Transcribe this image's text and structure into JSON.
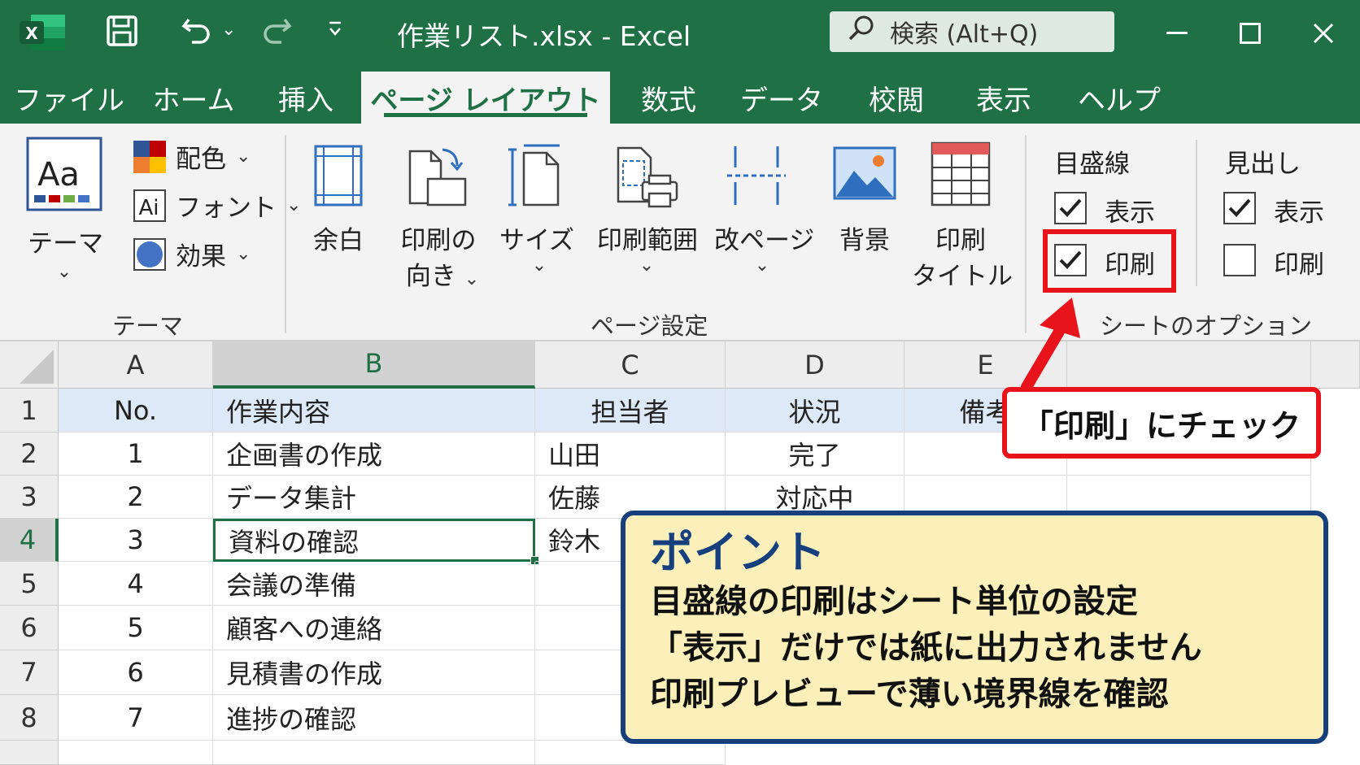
{
  "titlebar": {
    "file_title": "作業リスト.xlsx  -  Excel",
    "search_placeholder": "検索 (Alt+Q)"
  },
  "tabs": [
    "ファイル",
    "ホーム",
    "挿入",
    "ページ レイアウト",
    "数式",
    "データ",
    "校閲",
    "表示",
    "ヘルプ"
  ],
  "active_tab": "ページ レイアウト",
  "ribbon": {
    "theme": {
      "button_label": "テーマ",
      "colors_label": "配色",
      "fonts_label": "フォント",
      "effects_label": "効果",
      "group_label": "テーマ"
    },
    "page_setup": {
      "margins_label": "余白",
      "orientation_line1": "印刷の",
      "orientation_line2": "向き",
      "size_label": "サイズ",
      "print_area_label": "印刷範囲",
      "breaks_label": "改ページ",
      "background_label": "背景",
      "print_titles_line1": "印刷",
      "print_titles_line2": "タイトル",
      "group_label": "ページ設定"
    },
    "sheet_options": {
      "gridlines_label": "目盛線",
      "gridlines_view_label": "表示",
      "gridlines_view_checked": true,
      "gridlines_print_label": "印刷",
      "gridlines_print_checked": true,
      "headings_label": "見出し",
      "headings_view_label": "表示",
      "headings_view_checked": true,
      "headings_print_label": "印刷",
      "headings_print_checked": false,
      "group_label": "シートのオプション"
    }
  },
  "sheet": {
    "columns": [
      "A",
      "B",
      "C",
      "D",
      "E"
    ],
    "selected_column": "B",
    "selected_row": "4",
    "rows": [
      {
        "num": "1",
        "a": "No.",
        "b": "作業内容",
        "c": "担当者",
        "d": "状況",
        "e": "備考"
      },
      {
        "num": "2",
        "a": "1",
        "b": "企画書の作成",
        "c": "山田",
        "d": "完了",
        "e": ""
      },
      {
        "num": "3",
        "a": "2",
        "b": "データ集計",
        "c": "佐藤",
        "d": "対応中",
        "e": ""
      },
      {
        "num": "4",
        "a": "3",
        "b": "資料の確認",
        "c": "鈴木",
        "d": "",
        "e": ""
      },
      {
        "num": "5",
        "a": "4",
        "b": "会議の準備",
        "c": "",
        "d": "",
        "e": ""
      },
      {
        "num": "6",
        "a": "5",
        "b": "顧客への連絡",
        "c": "",
        "d": "",
        "e": ""
      },
      {
        "num": "7",
        "a": "6",
        "b": "見積書の作成",
        "c": "",
        "d": "",
        "e": ""
      },
      {
        "num": "8",
        "a": "7",
        "b": "進捗の確認",
        "c": "",
        "d": "",
        "e": ""
      }
    ]
  },
  "callout": {
    "red_text": "「印刷」にチェック"
  },
  "point": {
    "title": "ポイント",
    "line1": "目盛線の印刷はシート単位の設定",
    "line2": "「表示」だけでは紙に出力されません",
    "line3": "印刷プレビューで薄い境界線を確認"
  },
  "colors": {
    "excel_green": "#1f7145",
    "highlight_red": "#e8141b",
    "point_navy": "#163f7e",
    "point_bg": "#fbf0b9",
    "header_row_bg": "#dde9f6"
  }
}
